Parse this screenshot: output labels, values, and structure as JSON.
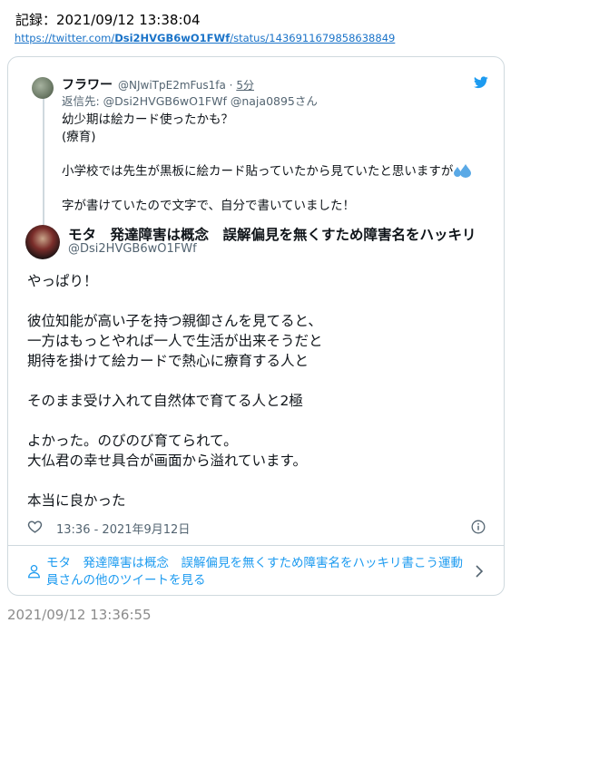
{
  "record": {
    "label": "記録：2021/09/12 13:38:04",
    "url_prefix": "https://twitter.com/",
    "url_user": "Dsi2HVGB6wO1FWf",
    "url_suffix": "/status/1436911679858638849"
  },
  "reply_tweet": {
    "name": "フラワー",
    "handle": "@NJwiTpE2mFus1fa",
    "separator": "·",
    "time_ago": "5分",
    "reply_to": "返信先: @Dsi2HVGB6wO1FWf @naja0895さん",
    "lines": [
      "幼少期は絵カード使ったかも？",
      "(療育)",
      "小学校では先生が黒板に絵カード貼っていたから見ていたと思いますが",
      "字が書けていたので文字で、自分で書いていました！"
    ]
  },
  "main_tweet": {
    "name": "モタ　発達障害は概念　誤解偏見を無くすため障害名をハッキリ",
    "handle": "@Dsi2HVGB6wO1FWf",
    "lines": [
      "やっぱり！",
      "",
      "彼位知能が高い子を持つ親御さんを見てると、",
      "一方はもっとやれば一人で生活が出来そうだと",
      "期待を掛けて絵カードで熱心に療育する人と",
      "",
      "そのまま受け入れて自然体で育てる人と2極",
      "",
      "よかった。のびのび育てられて。",
      "大仏君の幸せ具合が画面から溢れています。",
      "",
      "本当に良かった"
    ],
    "timestamp": "13:36 - 2021年9月12日"
  },
  "more_link": {
    "text": "モタ　発達障害は概念　誤解偏見を無くすため障害名をハッキリ書こう運動員さんの他のツイートを見る"
  },
  "footer": {
    "time": "2021/09/12 13:36:55"
  },
  "colors": {
    "accent": "#1d9bf0",
    "muted": "#536471",
    "border": "#cfd9de"
  }
}
